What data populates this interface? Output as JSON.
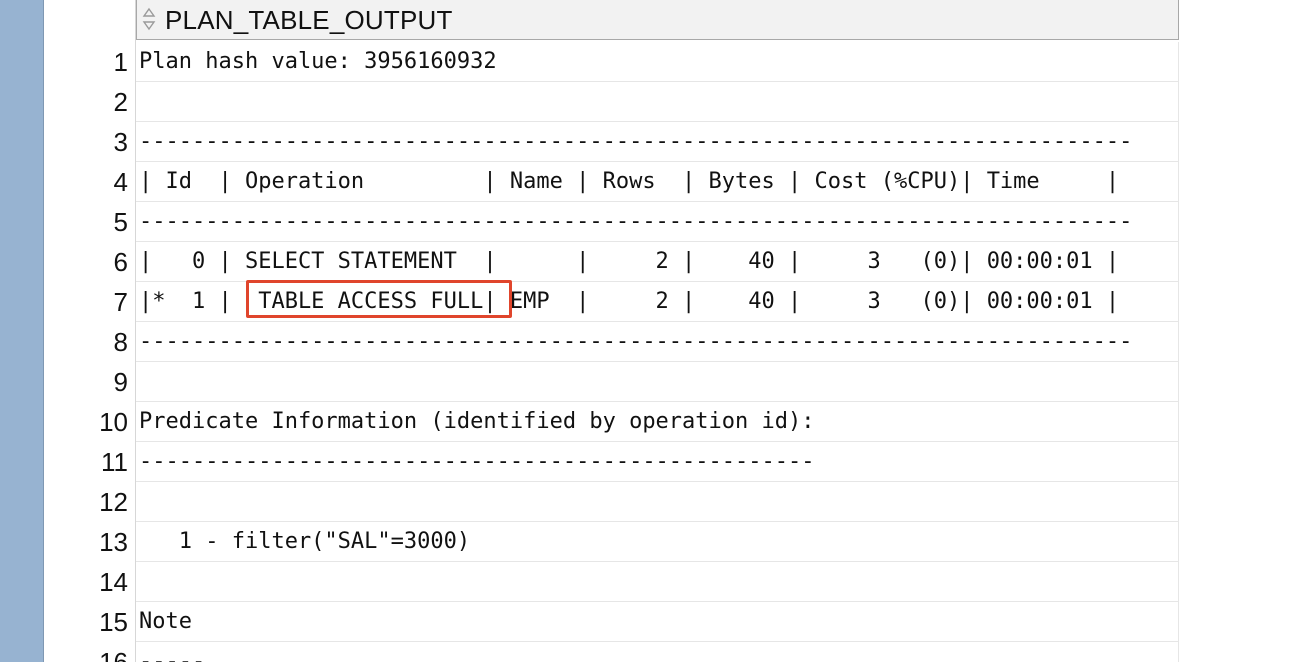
{
  "header": {
    "column_title": "PLAN_TABLE_OUTPUT",
    "sort_icon": "sort-arrows-icon"
  },
  "rows": [
    {
      "num": "1",
      "text": "Plan hash value: 3956160932"
    },
    {
      "num": "2",
      "text": ""
    },
    {
      "num": "3",
      "text": "---------------------------------------------------------------------------"
    },
    {
      "num": "4",
      "text": "| Id  | Operation         | Name | Rows  | Bytes | Cost (%CPU)| Time     |"
    },
    {
      "num": "5",
      "text": "---------------------------------------------------------------------------"
    },
    {
      "num": "6",
      "text": "|   0 | SELECT STATEMENT  |      |     2 |    40 |     3   (0)| 00:00:01 |"
    },
    {
      "num": "7",
      "text": "|*  1 |  TABLE ACCESS FULL| EMP  |     2 |    40 |     3   (0)| 00:00:01 |"
    },
    {
      "num": "8",
      "text": "---------------------------------------------------------------------------"
    },
    {
      "num": "9",
      "text": ""
    },
    {
      "num": "10",
      "text": "Predicate Information (identified by operation id):"
    },
    {
      "num": "11",
      "text": "---------------------------------------------------"
    },
    {
      "num": "12",
      "text": ""
    },
    {
      "num": "13",
      "text": "   1 - filter(\"SAL\"=3000)"
    },
    {
      "num": "14",
      "text": ""
    },
    {
      "num": "15",
      "text": "Note"
    },
    {
      "num": "16",
      "text": "-----"
    }
  ],
  "highlight": {
    "color": "#e0452c",
    "target_text": "TABLE ACCESS FULL"
  }
}
